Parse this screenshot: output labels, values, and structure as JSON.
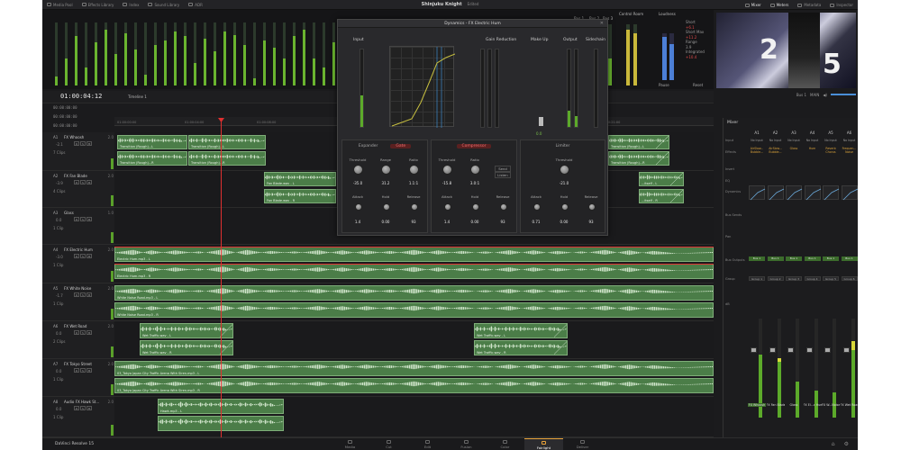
{
  "topbar": {
    "items": [
      "Media Pool",
      "Effects Library",
      "Index",
      "Sound Library",
      "ADR"
    ],
    "project_title": "Shinjuku Knight",
    "project_state": "Edited",
    "right_items": [
      "Mixer",
      "Meters",
      "Metadata",
      "Inspector"
    ]
  },
  "meter_bridge": {
    "bus_labels": [
      "Bus 1",
      "Bus 2",
      "Bus 3",
      "Control Room",
      "Loudness"
    ],
    "loudness_values": {
      "short_label": "Short",
      "short_value": "+6.1",
      "short_max_label": "Short Max",
      "short_max_value": "+11.2",
      "range_label": "Range",
      "range_value": "3.9",
      "integrated_label": "Integrated",
      "integrated_value": "+10.4",
      "pause": "Pause",
      "reset": "Reset"
    }
  },
  "viewer": {
    "zoom": "MAIN",
    "bus": "Bus 1"
  },
  "timeline": {
    "timecode": "01:00:04:12",
    "name": "Timeline 1",
    "timecode_rows": [
      "00:00:00:00",
      "00:00:00:00",
      "00:00:00:00"
    ],
    "ruler_labels": [
      "01:00:00:00",
      "01:00:04:00",
      "01:00:08:00",
      "01:00:21:00"
    ]
  },
  "tracks": [
    {
      "id": "A1",
      "name": "FX Whoosh",
      "vol": "-2.1",
      "clips": "7 Clips",
      "num": "2.0"
    },
    {
      "id": "A2",
      "name": "FX Fan Blade",
      "vol": "-3.9",
      "clips": "4 Clips",
      "num": "2.0"
    },
    {
      "id": "A3",
      "name": "Glass",
      "vol": "0.0",
      "clips": "1 Clip",
      "num": "1.0"
    },
    {
      "id": "A4",
      "name": "FX Electric Hum",
      "vol": "-3.0",
      "clips": "1 Clip",
      "num": "2.0"
    },
    {
      "id": "A5",
      "name": "FX White Noise",
      "vol": "-1.7",
      "clips": "1 Clip",
      "num": "2.0"
    },
    {
      "id": "A6",
      "name": "FX Wet Road",
      "vol": "0.0",
      "clips": "2 Clips",
      "num": "2.0"
    },
    {
      "id": "A7",
      "name": "FX Tokyo Street",
      "vol": "0.0",
      "clips": "1 Clip",
      "num": "2.0"
    },
    {
      "id": "A8",
      "name": "Audio FX Hawk St...",
      "vol": "0.0",
      "clips": "1 Clip",
      "num": "2.0"
    }
  ],
  "clips": {
    "whoosh_l": "Transition (Rough)...L",
    "whoosh_r": "Transition (Rough)...R",
    "fan_l": "Fan Blade.wav - L",
    "fan_r": "Fan Blade.wav - R",
    "whoosh2_l": "Transition (Rough)...L",
    "whoosh2_r": "Transition (Rough)...R",
    "edge1": "...itself - L",
    "edge2": "...itself - R",
    "hum_l": "Electric Hum.mp3 - L",
    "hum_r": "Electric Hum.mp3 - R",
    "noise_l": "White Noise Road.mp3 - L",
    "noise_r": "White Noise Road.mp3 - R",
    "wet1_l": "Wet Traffic.wav - L",
    "wet1_r": "Wet Traffic.wav - R",
    "wet2_l": "Wet Traffic.wav - L",
    "wet2_r": "Wet Traffic.wav - R",
    "tokyo_l": "03_Tokyo Japan City Traffic Arena With Siren.mp3 - L",
    "tokyo_r": "03_Tokyo Japan City Traffic Arena With Siren.mp3 - R",
    "hawk_l": "Hawk.mp3 - L"
  },
  "dynamics": {
    "title": "Dynamics - FX Electric Hum",
    "input": "Input",
    "gain_reduction": "Gain Reduction",
    "make_up": "Make Up",
    "output": "Output",
    "sidechain": "Sidechain",
    "make_up_value": "0.0",
    "expander": {
      "label": "Expander",
      "gate": "Gate",
      "knobs": [
        {
          "label": "Threshold",
          "value": "-35.0"
        },
        {
          "label": "Range",
          "value": "31.2"
        },
        {
          "label": "Ratio",
          "value": "1.1:1"
        },
        {
          "label": "Attack",
          "value": "1.4"
        },
        {
          "label": "Hold",
          "value": "0.00"
        },
        {
          "label": "Release",
          "value": "93"
        }
      ]
    },
    "compressor": {
      "label": "Compressor",
      "send": "Send",
      "listen": "Listen",
      "knobs": [
        {
          "label": "Threshold",
          "value": "-15.8"
        },
        {
          "label": "Ratio",
          "value": "3.0:1"
        },
        {
          "label": "Attack",
          "value": "1.4"
        },
        {
          "label": "Hold",
          "value": "0.00"
        },
        {
          "label": "Release",
          "value": "93"
        }
      ]
    },
    "limiter": {
      "label": "Limiter",
      "knobs": [
        {
          "label": "Threshold",
          "value": "-21.0"
        },
        {
          "label": "Attack",
          "value": "0.71"
        },
        {
          "label": "Hold",
          "value": "0.00"
        },
        {
          "label": "Release",
          "value": "93"
        }
      ]
    }
  },
  "mixer": {
    "title": "Mixer",
    "row_labels": [
      "Input",
      "Effects",
      "Insert",
      "EQ",
      "Dynamics",
      "Bus Sends",
      "Pan",
      "Bus Outputs",
      "Group",
      "dB"
    ],
    "strips": [
      {
        "id": "A1",
        "input": "No Input",
        "effects": "AirSlow... Bubble...",
        "bus": "Bus 1",
        "group": "Group 1",
        "name": "FX Whoosh"
      },
      {
        "id": "A2",
        "input": "No Input",
        "effects": "AirSlow... Bubble...",
        "bus": "Bus 1",
        "group": "Group 2",
        "name": "FX Fan Blade"
      },
      {
        "id": "A3",
        "input": "No Input",
        "effects": "Glass",
        "bus": "Bus 1",
        "group": "Group 3",
        "name": "Glass"
      },
      {
        "id": "A4",
        "input": "No Input",
        "effects": "Hum",
        "bus": "Bus 1",
        "group": "Group 4",
        "name": "FX El...c Hum"
      },
      {
        "id": "A5",
        "input": "No Input",
        "effects": "Reverb Chorus",
        "bus": "Bus 1",
        "group": "Group 5",
        "name": "FX W...Noise"
      },
      {
        "id": "A6",
        "input": "No Input",
        "effects": "Frequen... Noise",
        "bus": "Bus 1",
        "group": "Group 6",
        "name": "FX Wet Road"
      },
      {
        "id": "Bus 1",
        "input": "",
        "effects": "",
        "bus": "",
        "group": "",
        "name": "Bus 1"
      }
    ]
  },
  "pagebar": {
    "brand": "DaVinci Resolve 15",
    "pages": [
      "Media",
      "Cut",
      "Edit",
      "Fusion",
      "Color",
      "Fairlight",
      "Deliver"
    ],
    "active_page": "Fairlight"
  }
}
